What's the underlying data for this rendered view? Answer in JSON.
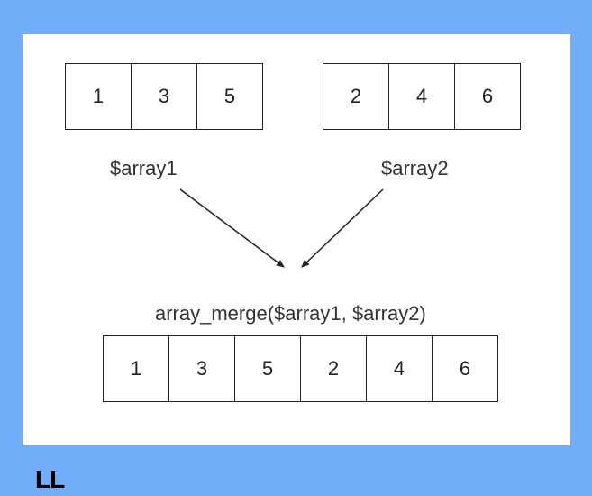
{
  "array1": {
    "label": "$array1",
    "cells": [
      "1",
      "3",
      "5"
    ]
  },
  "array2": {
    "label": "$array2",
    "cells": [
      "2",
      "4",
      "6"
    ]
  },
  "merge_label": "array_merge($array1, $array2)",
  "merged": {
    "cells": [
      "1",
      "3",
      "5",
      "2",
      "4",
      "6"
    ]
  },
  "watermark": "LL"
}
